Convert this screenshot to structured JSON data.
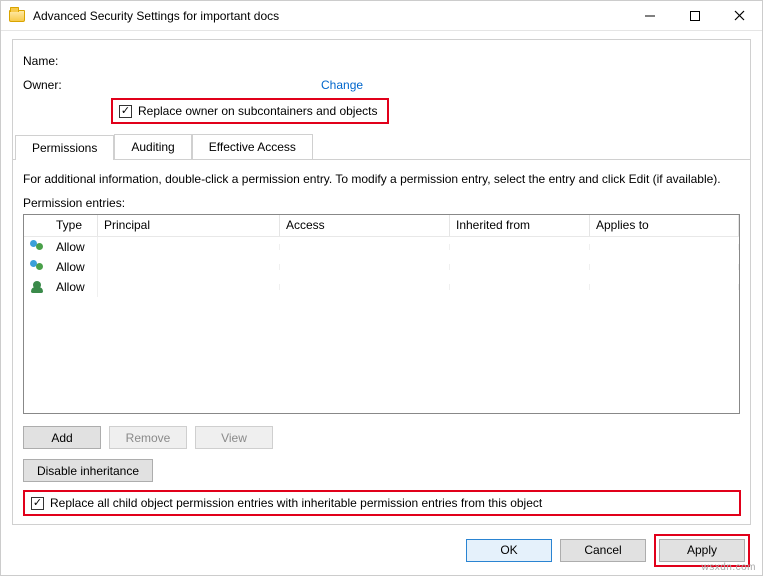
{
  "window": {
    "title": "Advanced Security Settings for important docs"
  },
  "labels": {
    "name": "Name:",
    "owner": "Owner:",
    "change_link": "Change",
    "replace_owner": "Replace owner on subcontainers and objects",
    "info": "For additional information, double-click a permission entry. To modify a permission entry, select the entry and click Edit (if available).",
    "permission_entries": "Permission entries:",
    "replace_child": "Replace all child object permission entries with inheritable permission entries from this object"
  },
  "tabs": {
    "permissions": "Permissions",
    "auditing": "Auditing",
    "effective": "Effective Access"
  },
  "grid": {
    "headers": {
      "type": "Type",
      "principal": "Principal",
      "access": "Access",
      "inherited": "Inherited from",
      "applies": "Applies to"
    },
    "rows": [
      {
        "icon": "group",
        "type": "Allow"
      },
      {
        "icon": "group",
        "type": "Allow"
      },
      {
        "icon": "single",
        "type": "Allow"
      }
    ]
  },
  "buttons": {
    "add": "Add",
    "remove": "Remove",
    "view": "View",
    "disable_inheritance": "Disable inheritance",
    "ok": "OK",
    "cancel": "Cancel",
    "apply": "Apply"
  },
  "watermark": "wsxdn.com"
}
